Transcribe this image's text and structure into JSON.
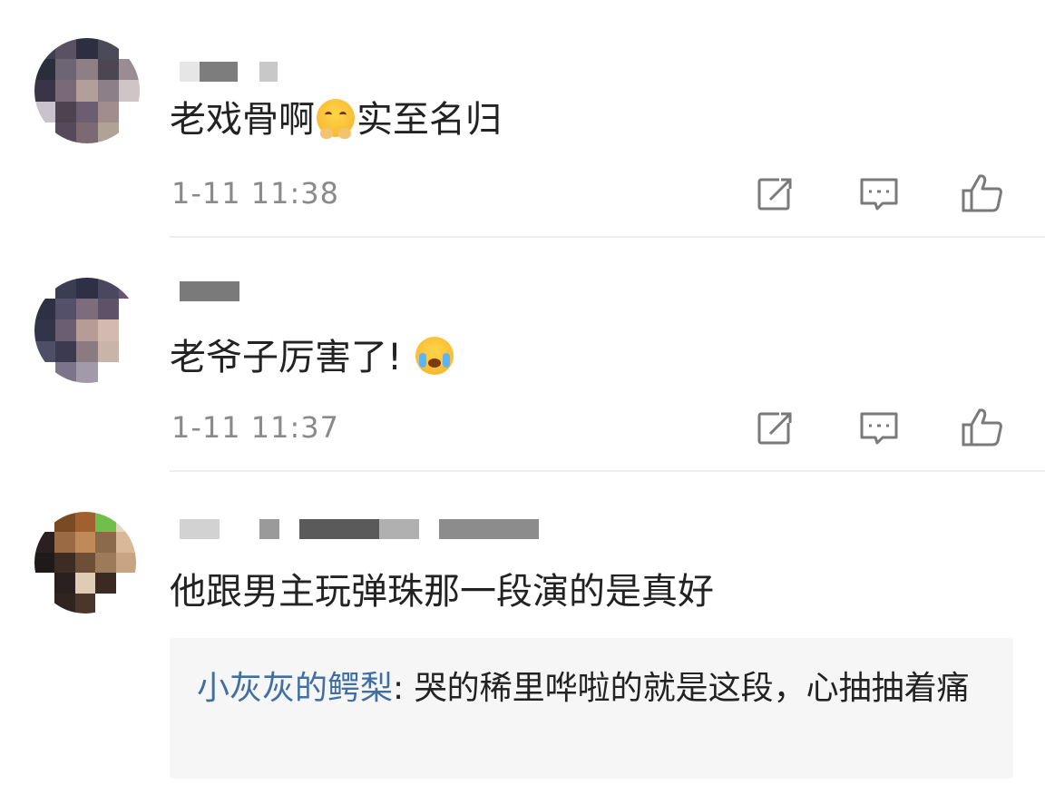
{
  "comments": [
    {
      "text_before": "老戏骨啊",
      "emoji": "shy-face-emoji",
      "text_after": "实至名归",
      "time": "1-11 11:38"
    },
    {
      "text_before": "老爷子厉害了!",
      "emoji": "crying-laughing-emoji",
      "text_after": "",
      "time": "1-11 11:37"
    },
    {
      "text_before": "他跟男主玩弹珠那一段演的是真好",
      "emoji": "",
      "text_after": "",
      "time": "",
      "reply": {
        "user": "小灰灰的鳄梨",
        "separator": ": ",
        "text": "哭的稀里哗啦的就是这段，心抽抽着痛"
      }
    }
  ],
  "actions": {
    "share_icon": "share-icon",
    "comment_icon": "comment-icon",
    "like_icon": "thumbs-up-icon"
  },
  "colors": {
    "text": "#222222",
    "time": "#8a8a8a",
    "reply_user": "#3f6fa3",
    "quote_bg": "#f6f6f6",
    "icon": "#7a7a7a"
  }
}
